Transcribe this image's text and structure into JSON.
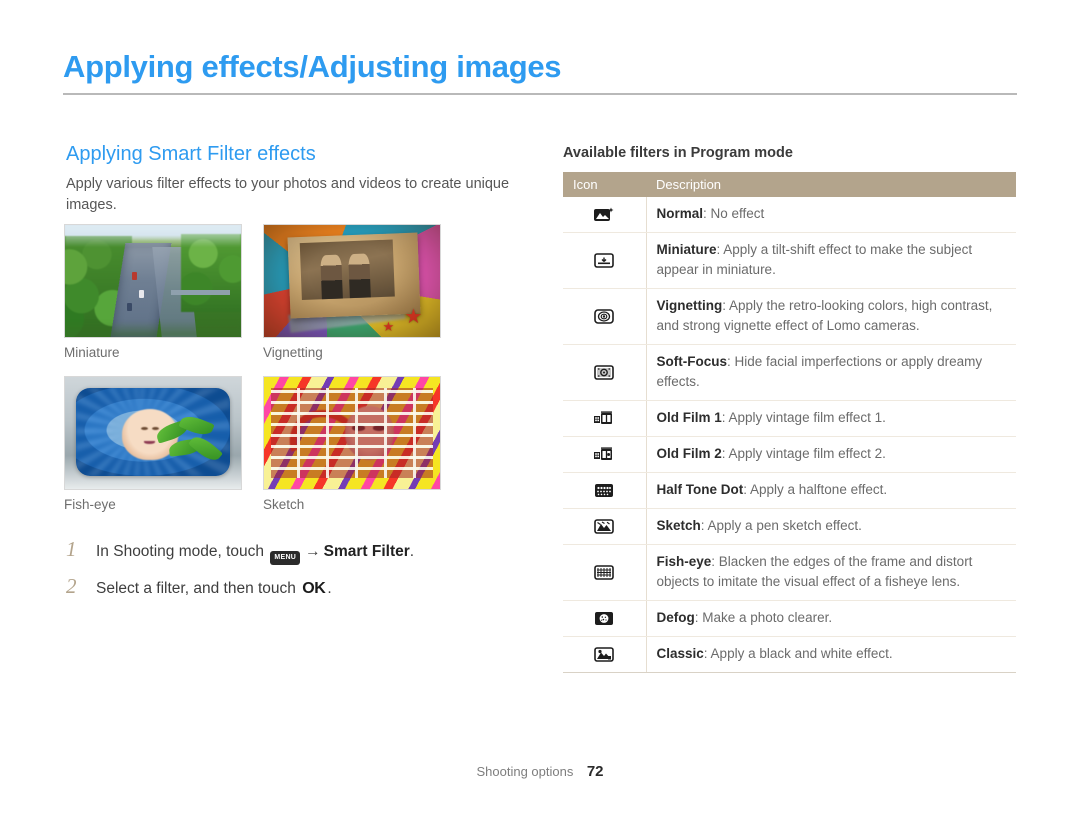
{
  "header": {
    "title": "Applying effects/Adjusting images"
  },
  "left": {
    "section_title": "Applying Smart Filter effects",
    "body": "Apply various filter effects to your photos and videos to create unique images.",
    "samples": [
      {
        "caption": "Miniature",
        "art": "miniature"
      },
      {
        "caption": "Vignetting",
        "art": "vignetting"
      },
      {
        "caption": "Fish-eye",
        "art": "fisheye"
      },
      {
        "caption": "Sketch",
        "art": "sketch"
      }
    ],
    "steps": [
      {
        "number": "1",
        "pre": "In Shooting mode, touch ",
        "icon": "menu-icon",
        "icon_label": "MENU",
        "arrow": "→",
        "bold": "Smart Filter",
        "post": "."
      },
      {
        "number": "2",
        "pre": "Select a filter, and then touch ",
        "icon": "ok-icon",
        "icon_label": "OK",
        "post": "."
      }
    ]
  },
  "table": {
    "title": "Available filters in Program mode",
    "columns": [
      "Icon",
      "Description"
    ],
    "header_bg": "#b3a48c",
    "rows": [
      {
        "icon": "normal-filter-icon",
        "name": "Normal",
        "desc": ": No effect"
      },
      {
        "icon": "miniature-filter-icon",
        "name": "Miniature",
        "desc": ": Apply a tilt-shift effect to make the subject appear in miniature."
      },
      {
        "icon": "vignetting-filter-icon",
        "name": "Vignetting",
        "desc": ": Apply the retro-looking colors, high contrast, and strong vignette effect of Lomo cameras."
      },
      {
        "icon": "soft-focus-filter-icon",
        "name": "Soft-Focus",
        "desc": ": Hide facial imperfections or apply dreamy effects."
      },
      {
        "icon": "old-film-1-filter-icon",
        "name": "Old Film 1",
        "desc": ": Apply vintage film effect 1."
      },
      {
        "icon": "old-film-2-filter-icon",
        "name": "Old Film 2",
        "desc": ": Apply vintage film effect 2."
      },
      {
        "icon": "half-tone-dot-filter-icon",
        "name": "Half Tone Dot",
        "desc": ": Apply a halftone effect."
      },
      {
        "icon": "sketch-filter-icon",
        "name": "Sketch",
        "desc": ": Apply a pen sketch effect."
      },
      {
        "icon": "fish-eye-filter-icon",
        "name": "Fish-eye",
        "desc": ": Blacken the edges of the frame and distort objects to imitate the visual effect of a fisheye lens."
      },
      {
        "icon": "defog-filter-icon",
        "name": "Defog",
        "desc": ": Make a photo clearer."
      },
      {
        "icon": "classic-filter-icon",
        "name": "Classic",
        "desc": ": Apply a black and white effect."
      }
    ]
  },
  "footer": {
    "section": "Shooting options",
    "page": "72"
  },
  "colors": {
    "accent_blue": "#2e9bf0",
    "table_header": "#b3a48c",
    "body_text": "#565656"
  }
}
